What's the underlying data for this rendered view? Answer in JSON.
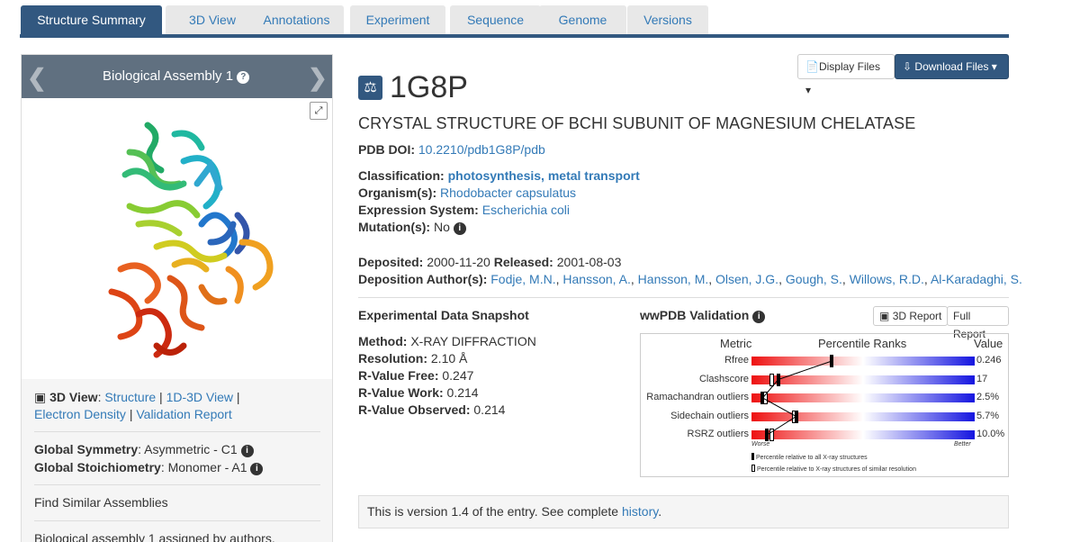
{
  "tabs": [
    "Structure Summary",
    "3D View",
    "Annotations",
    "Experiment",
    "Sequence",
    "Genome",
    "Versions"
  ],
  "assembly": {
    "title": "Biological Assembly 1",
    "view3d_label": "3D View",
    "view3d_links": [
      "Structure",
      "1D-3D View",
      "Electron Density",
      "Validation Report"
    ],
    "symmetry_label": "Global Symmetry",
    "symmetry_value": "Asymmetric - C1",
    "stoich_label": "Global Stoichiometry",
    "stoich_value": "Monomer - A1",
    "similar": "Find Similar Assemblies",
    "note": "Biological assembly 1 assigned by authors."
  },
  "buttons": {
    "display": "Display Files",
    "download": "Download Files"
  },
  "entry": {
    "id": "1G8P",
    "title": "CRYSTAL STRUCTURE OF BCHI SUBUNIT OF MAGNESIUM CHELATASE",
    "doi_label": "PDB DOI:",
    "doi": "10.2210/pdb1G8P/pdb",
    "classification_label": "Classification:",
    "classification": "photosynthesis, metal transport",
    "organism_label": "Organism(s):",
    "organism": "Rhodobacter capsulatus",
    "expression_label": "Expression System:",
    "expression": "Escherichia coli",
    "mutation_label": "Mutation(s):",
    "mutation": "No",
    "deposited_label": "Deposited:",
    "deposited": "2000-11-20",
    "released_label": "Released:",
    "released": "2001-08-03",
    "authors_label": "Deposition Author(s):",
    "authors": [
      "Fodje, M.N.",
      "Hansson, A.",
      "Hansson, M.",
      "Olsen, J.G.",
      "Gough, S.",
      "Willows, R.D.",
      "Al-Karadaghi, S."
    ]
  },
  "experimental": {
    "heading": "Experimental Data Snapshot",
    "method_label": "Method:",
    "method": "X-RAY DIFFRACTION",
    "resolution_label": "Resolution:",
    "resolution": "2.10 Å",
    "rfree_label": "R-Value Free:",
    "rfree": "0.247",
    "rwork_label": "R-Value Work:",
    "rwork": "0.214",
    "robs_label": "R-Value Observed:",
    "robs": "0.214"
  },
  "validation": {
    "heading": "wwPDB Validation",
    "report3d": "3D Report",
    "full_report": "Full Report",
    "col_metric": "Metric",
    "col_ranks": "Percentile Ranks",
    "col_value": "Value",
    "worse": "Worse",
    "better": "Better",
    "legend_all": "Percentile relative to all X-ray structures",
    "legend_similar": "Percentile relative to X-ray structures of similar resolution",
    "metrics": [
      {
        "name": "Rfree",
        "value": "0.246",
        "pct_all": 36,
        "pct_sim": null
      },
      {
        "name": "Clashscore",
        "value": "17",
        "pct_all": 12,
        "pct_sim": 9
      },
      {
        "name": "Ramachandran outliers",
        "value": "2.5%",
        "pct_all": 5,
        "pct_sim": 6
      },
      {
        "name": "Sidechain outliers",
        "value": "5.7%",
        "pct_all": 20,
        "pct_sim": 19
      },
      {
        "name": "RSRZ outliers",
        "value": "10.0%",
        "pct_all": 7,
        "pct_sim": 9
      }
    ]
  },
  "version": {
    "text": "This is version 1.4 of the entry. See complete",
    "link": "history",
    "end": "."
  },
  "colors": {
    "nav": "#325880",
    "link": "#337ab7",
    "assembly_header": "#607080"
  }
}
